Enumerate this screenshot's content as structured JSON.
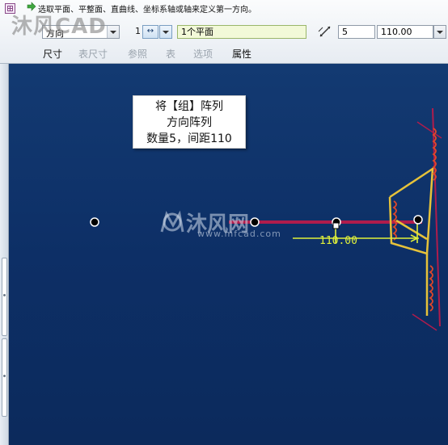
{
  "message": "选取平面、平整面、直曲线、坐标系轴或轴来定义第一方向。",
  "dashboard": {
    "type_dropdown": "方向",
    "first_direction_count_label": "1",
    "direction_flip_glyph": "↔",
    "reference_collector": "1个平面",
    "member_count": "5",
    "spacing": "110.00"
  },
  "tabs": [
    {
      "label": "尺寸",
      "active": true
    },
    {
      "label": "表尺寸",
      "active": false
    },
    {
      "label": "参照",
      "active": false
    },
    {
      "label": "表",
      "active": false
    },
    {
      "label": "选项",
      "active": false
    },
    {
      "label": "属性",
      "active": true
    }
  ],
  "note": {
    "line1": "将【组】阵列",
    "line2": "方向阵列",
    "line3": "数量5，间距110"
  },
  "dimension_label": "110.00",
  "watermark": {
    "top": "沐风CAD",
    "middle": "沐风网",
    "url": "www.mfcad.com"
  },
  "colors": {
    "canvas_top": "#133a72",
    "canvas_bottom": "#0c2a5c",
    "pattern_line": "#b01c4c",
    "geometry_yellow": "#e6c23a",
    "dimension": "#e0f03a",
    "coil": "#e0472a",
    "collector_bg": "#f2f9d8"
  }
}
